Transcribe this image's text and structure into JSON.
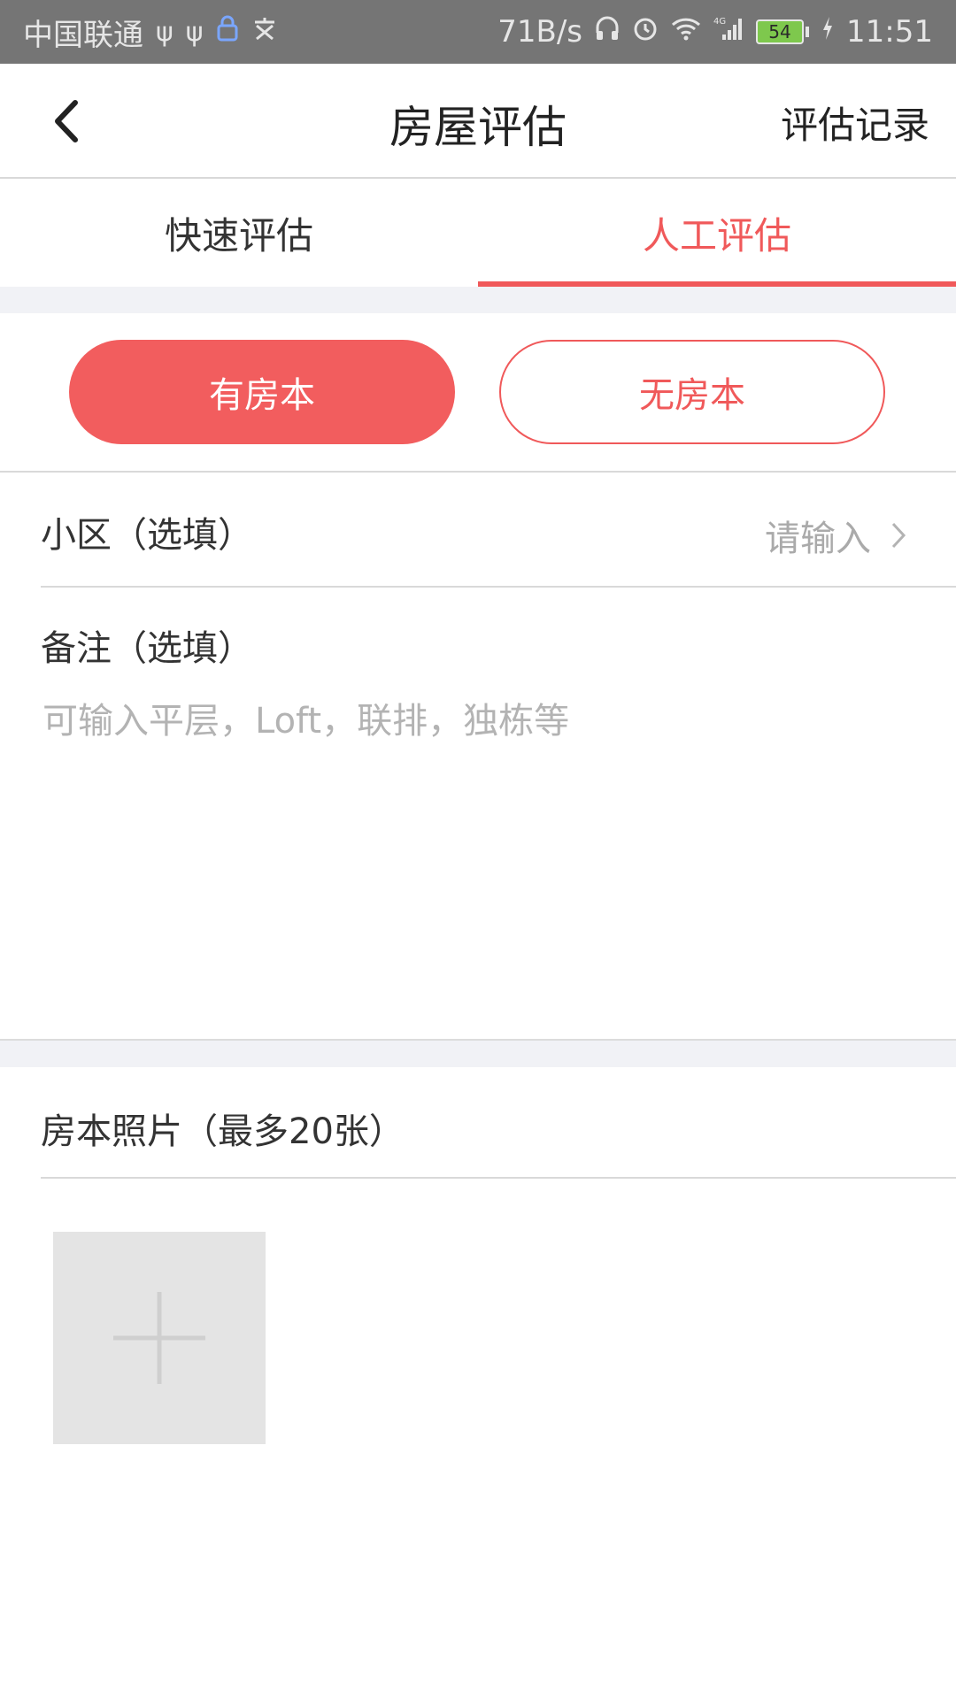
{
  "status_bar": {
    "carrier": "中国联通",
    "network_speed": "71B/s",
    "network_type": "4G",
    "battery_level": "54",
    "time": "11:51"
  },
  "navbar": {
    "title": "房屋评估",
    "right_action": "评估记录"
  },
  "tabs": [
    {
      "label": "快速评估",
      "active": false
    },
    {
      "label": "人工评估",
      "active": true
    }
  ],
  "toggle": {
    "option_with_deed": "有房本",
    "option_without_deed": "无房本",
    "selected": "有房本"
  },
  "form": {
    "community_label": "小区（选填）",
    "community_placeholder": "请输入",
    "remark_label": "备注（选填）",
    "remark_placeholder": "可输入平层，Loft，联排，独栋等"
  },
  "photos": {
    "title": "房本照片（最多20张）"
  },
  "colors": {
    "accent": "#f0595a",
    "status_bar_bg": "#757575",
    "section_gap_bg": "#f1f2f6",
    "add_photo_bg": "#e4e4e4"
  },
  "icons": {
    "back": "chevron-left-icon",
    "row_arrow": "chevron-right-icon",
    "add_photo": "plus-icon"
  }
}
